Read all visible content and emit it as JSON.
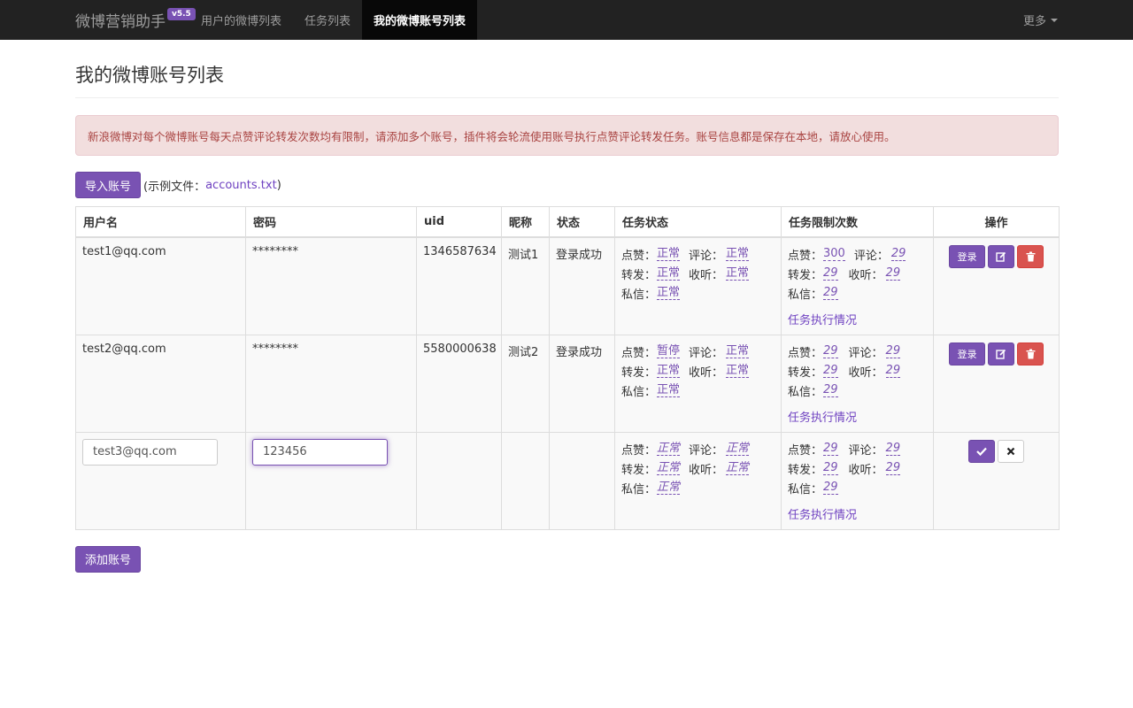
{
  "navbar": {
    "brand": "微博营销助手",
    "version": "v5.5",
    "items": [
      {
        "label": "用户的微博列表"
      },
      {
        "label": "任务列表"
      },
      {
        "label": "我的微博账号列表"
      }
    ],
    "more": "更多"
  },
  "page": {
    "title": "我的微博账号列表",
    "alert": "新浪微博对每个微博账号每天点赞评论转发次数均有限制，请添加多个账号，插件将会轮流使用账号执行点赞评论转发任务。账号信息都是保存在本地，请放心使用。",
    "import_button": "导入账号",
    "example_prefix": "(示例文件：",
    "example_link": "accounts.txt",
    "example_suffix": ")",
    "add_button": "添加账号"
  },
  "table": {
    "headers": {
      "username": "用户名",
      "password": "密码",
      "uid": "uid",
      "nickname": "昵称",
      "status": "状态",
      "task_status": "任务状态",
      "task_limits": "任务限制次数",
      "actions": "操作"
    },
    "labels": {
      "like": "点赞：",
      "comment": "评论：",
      "repost": "转发：",
      "listen": "收听：",
      "message": "私信："
    },
    "exec_link": "任务执行情况",
    "login_button": "登录",
    "rows": [
      {
        "username": "test1@qq.com",
        "password": "********",
        "uid": "1346587634",
        "nickname": "测试1",
        "status": "登录成功",
        "task_status": {
          "like": "正常",
          "comment": "正常",
          "repost": "正常",
          "listen": "正常",
          "message": "正常"
        },
        "limits": {
          "like": "300",
          "comment": "29",
          "repost": "29",
          "listen": "29",
          "message": "29"
        }
      },
      {
        "username": "test2@qq.com",
        "password": "********",
        "uid": "5580000638",
        "nickname": "测试2",
        "status": "登录成功",
        "task_status": {
          "like": "暂停",
          "comment": "正常",
          "repost": "正常",
          "listen": "正常",
          "message": "正常"
        },
        "limits": {
          "like": "29",
          "comment": "29",
          "repost": "29",
          "listen": "29",
          "message": "29"
        }
      },
      {
        "username_input": "test3@qq.com",
        "password_input": "123456",
        "task_status": {
          "like": "正常",
          "comment": "正常",
          "repost": "正常",
          "listen": "正常",
          "message": "正常"
        },
        "limits": {
          "like": "29",
          "comment": "29",
          "repost": "29",
          "listen": "29",
          "message": "29"
        }
      }
    ]
  },
  "colors": {
    "accent": "#7952b3",
    "navbar_bg": "#222222",
    "alert_bg": "#f2dede",
    "alert_text": "#a94442",
    "danger": "#d9534f"
  },
  "icons": {
    "edit": "edit-icon",
    "delete": "trash-icon",
    "confirm": "check-icon",
    "cancel": "close-icon"
  }
}
